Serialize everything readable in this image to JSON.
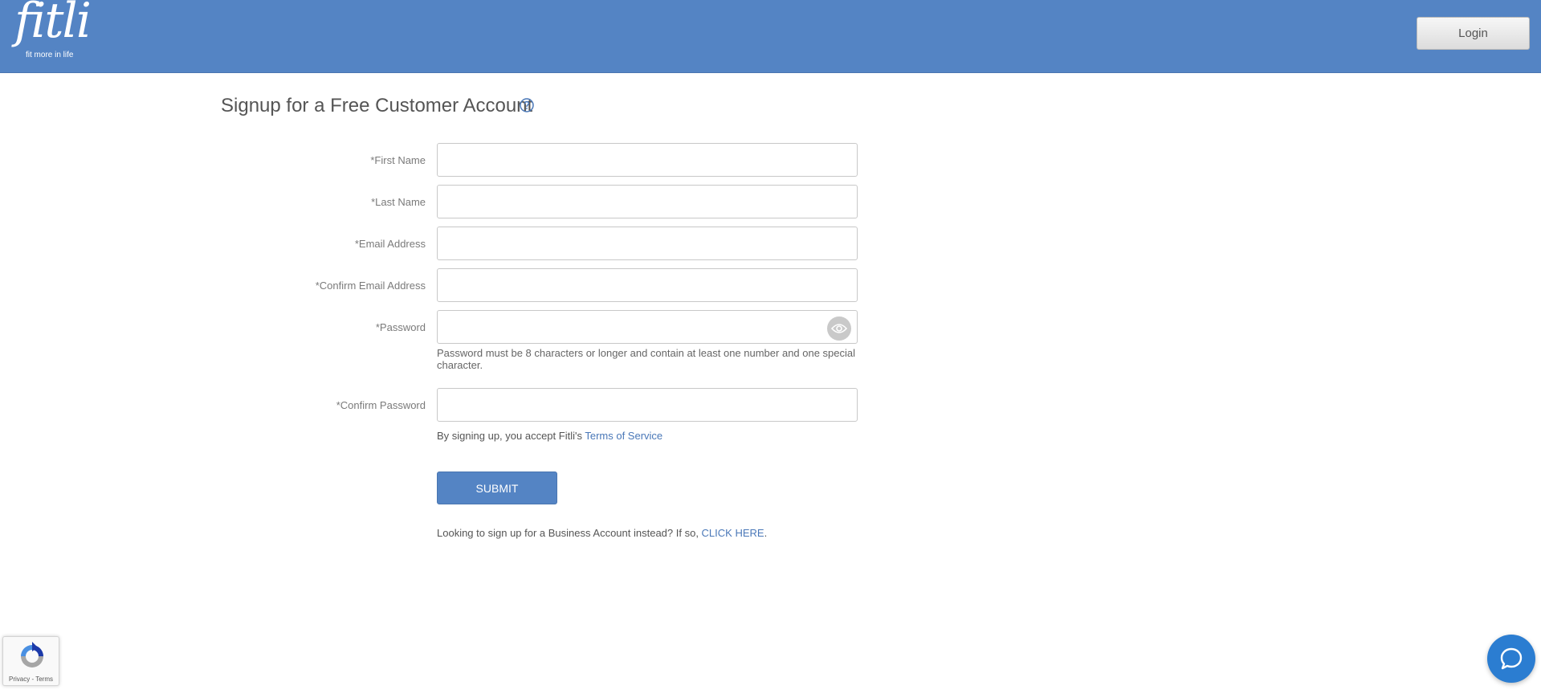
{
  "header": {
    "logo_word": "fitli",
    "logo_tagline": "fit more in life",
    "login_label": "Login",
    "background_color": "#5484c4"
  },
  "page": {
    "title": "Signup for a Free Customer Account",
    "help_icon": "question-circle-icon"
  },
  "form": {
    "fields": [
      {
        "label": "*First Name",
        "value": "",
        "placeholder": ""
      },
      {
        "label": "*Last Name",
        "value": "",
        "placeholder": ""
      },
      {
        "label": "*Email Address",
        "value": "",
        "placeholder": ""
      },
      {
        "label": "*Confirm Email Address",
        "value": "",
        "placeholder": ""
      },
      {
        "label": "*Password",
        "value": "",
        "placeholder": ""
      },
      {
        "label": "*Confirm Password",
        "value": "",
        "placeholder": ""
      }
    ],
    "password_hint": "Password must be 8 characters or longer and contain at least one number and one special character.",
    "password_toggle_icon": "eye-icon",
    "terms_prefix": "By signing up, you accept Fitli's ",
    "terms_link": "Terms of Service",
    "submit_label": "SUBMIT",
    "business_prefix": "Looking to sign up for a Business Account instead? If so, ",
    "business_link": "CLICK HERE",
    "business_suffix": "."
  },
  "recaptcha": {
    "links": "Privacy - Terms",
    "icon": "recaptcha-icon"
  },
  "chat": {
    "icon": "chat-bubble-icon",
    "color": "#2b7dd1"
  }
}
